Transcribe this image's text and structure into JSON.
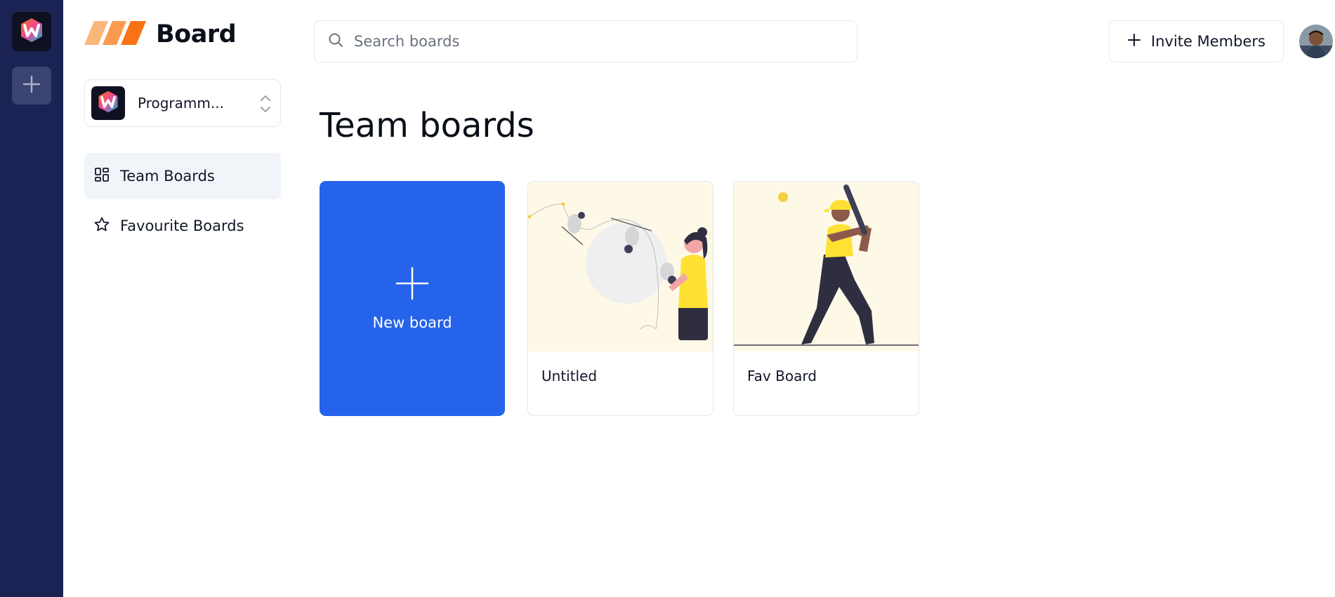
{
  "app": {
    "title": "Board"
  },
  "brand": {
    "accent": "#2563eb",
    "rail_bg": "#1a2353",
    "logo_stripes": [
      "#fbb77a",
      "#fb8c3c",
      "#f97316"
    ]
  },
  "rail": {
    "org_icon": "workspace-logo-icon",
    "add_icon": "plus-icon"
  },
  "org_switcher": {
    "name": "Programm...",
    "icon": "chevron-up-down-icon"
  },
  "nav": {
    "items": [
      {
        "label": "Team Boards",
        "icon": "dashboard-grid-icon",
        "active": true
      },
      {
        "label": "Favourite Boards",
        "icon": "star-icon",
        "active": false
      }
    ]
  },
  "search": {
    "placeholder": "Search boards",
    "value": ""
  },
  "header": {
    "invite_label": "Invite Members"
  },
  "main": {
    "title": "Team boards",
    "new_board_label": "New board",
    "boards": [
      {
        "title": "Untitled"
      },
      {
        "title": "Fav Board"
      }
    ]
  }
}
